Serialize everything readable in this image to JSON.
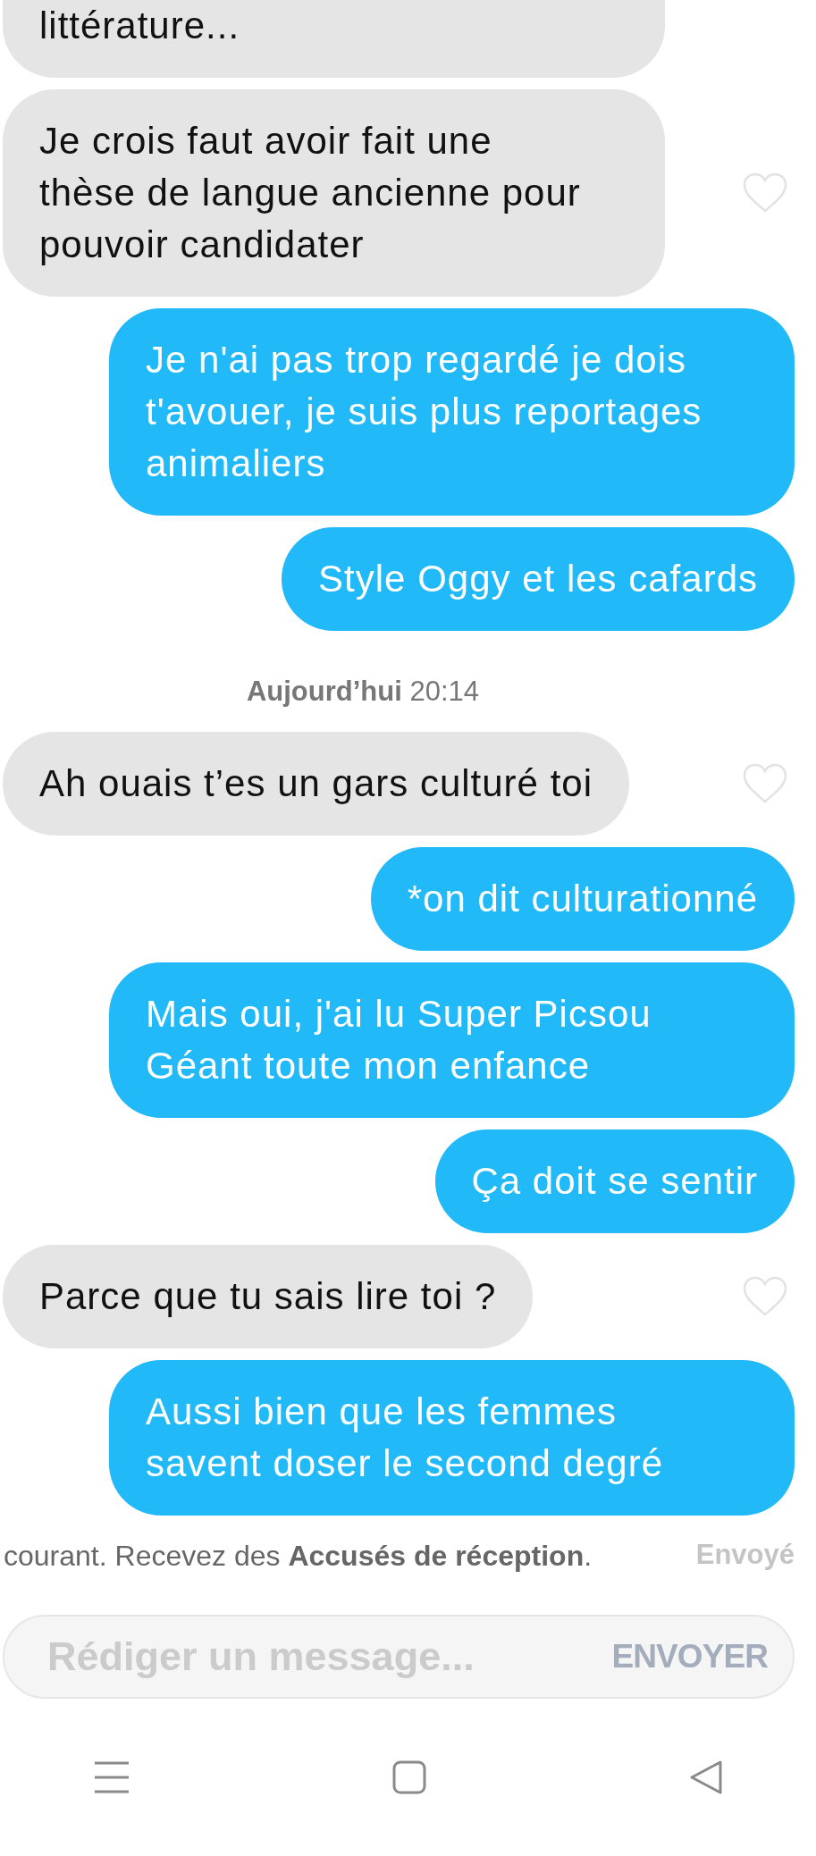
{
  "messages": [
    {
      "kind": "them",
      "lines": [
        "littérature..."
      ]
    },
    {
      "kind": "them",
      "lines": [
        "Je crois faut avoir fait une",
        "thèse de langue ancienne pour",
        "pouvoir candidater"
      ],
      "liked": false
    },
    {
      "kind": "me",
      "lines": [
        "Je n'ai pas trop regardé je dois",
        "t'avouer, je suis plus reportages",
        "animaliers"
      ]
    },
    {
      "kind": "me",
      "lines": [
        "Style Oggy et les cafards"
      ]
    },
    {
      "kind": "stamp",
      "day": "Aujourd’hui",
      "time": "20:14"
    },
    {
      "kind": "them",
      "lines": [
        "Ah ouais t’es un gars culturé toi"
      ],
      "liked": false
    },
    {
      "kind": "me",
      "lines": [
        "*on dit culturationné"
      ]
    },
    {
      "kind": "me",
      "lines": [
        "Mais oui, j'ai lu Super Picsou",
        "Géant toute mon enfance"
      ]
    },
    {
      "kind": "me",
      "lines": [
        "Ça doit se sentir"
      ]
    },
    {
      "kind": "them",
      "lines": [
        "Parce que tu sais lire toi ?"
      ],
      "liked": false
    },
    {
      "kind": "me",
      "lines": [
        "Aussi bien que les femmes",
        "savent doser le second degré"
      ]
    }
  ],
  "receipt_notice": "courant. Recevez des **Accusés de réception**.",
  "delivery_status": "Envoyé",
  "composer": {
    "placeholder": "Rédiger un message...",
    "send_label": "ENVOYER"
  }
}
